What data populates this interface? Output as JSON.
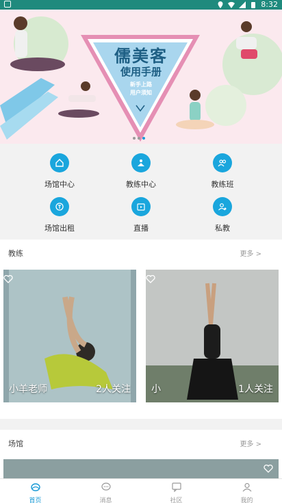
{
  "status": {
    "time": "8:32"
  },
  "banner": {
    "title": "儒美客",
    "subtitle": "使用手册",
    "line1": "新手上路",
    "line2": "用户须知"
  },
  "menu": [
    {
      "label": "场馆中心",
      "icon": "home-icon"
    },
    {
      "label": "教练中心",
      "icon": "coach-icon"
    },
    {
      "label": "教练班",
      "icon": "group-icon"
    },
    {
      "label": "场馆出租",
      "icon": "rent-icon"
    },
    {
      "label": "直播",
      "icon": "live-icon"
    },
    {
      "label": "私教",
      "icon": "private-coach-icon"
    }
  ],
  "coach_section": {
    "title": "教练",
    "more": "更多 >",
    "cards": [
      {
        "name": "小羊老师",
        "follow": "2人关注"
      },
      {
        "name": "小",
        "follow": "1人关注"
      }
    ]
  },
  "venue_section": {
    "title": "场馆",
    "more": "更多 >"
  },
  "tabs": [
    {
      "label": "首页",
      "active": true
    },
    {
      "label": "消息",
      "active": false
    },
    {
      "label": "社区",
      "active": false
    },
    {
      "label": "我的",
      "active": false
    }
  ],
  "colors": {
    "accent": "#1aa6dd",
    "status_bar": "#1f8a7d",
    "banner_bg": "#fbe9ee"
  }
}
